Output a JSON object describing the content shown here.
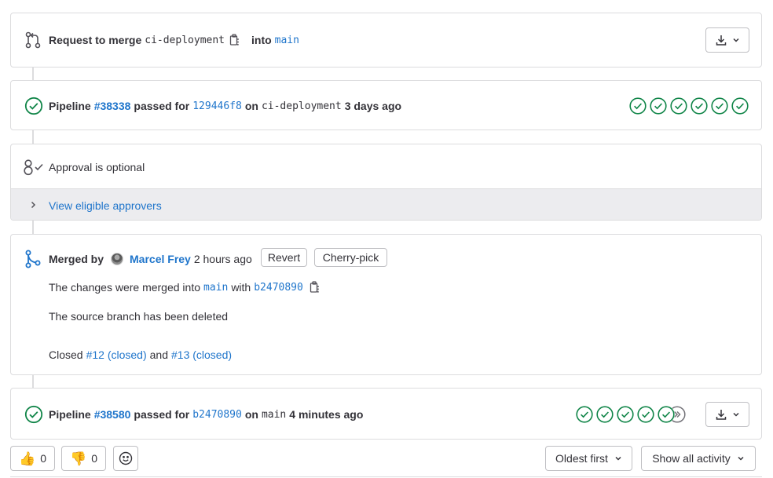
{
  "merge_request": {
    "prefix": "Request to merge",
    "source_branch": "ci-deployment",
    "into": "into",
    "target_branch": "main"
  },
  "pipeline1": {
    "label": "Pipeline",
    "id": "#38338",
    "passed_for": "passed for",
    "commit": "129446f8",
    "on": "on",
    "branch": "ci-deployment",
    "time": "3 days ago",
    "stages": [
      "passed",
      "passed",
      "passed",
      "passed",
      "passed",
      "passed"
    ]
  },
  "approval": {
    "text": "Approval is optional",
    "view_approvers": "View eligible approvers"
  },
  "merged": {
    "merged_by": "Merged by",
    "author": "Marcel Frey",
    "time": "2 hours ago",
    "revert": "Revert",
    "cherry_pick": "Cherry-pick",
    "changes_prefix": "The changes were merged into",
    "target": "main",
    "with": "with",
    "commit": "b2470890",
    "branch_deleted": "The source branch has been deleted",
    "closed_label": "Closed",
    "issue1": "#12 (closed)",
    "and": "and",
    "issue2": "#13 (closed)"
  },
  "pipeline2": {
    "label": "Pipeline",
    "id": "#38580",
    "passed_for": "passed for",
    "commit": "b2470890",
    "on": "on",
    "branch": "main",
    "time": "4 minutes ago",
    "stages": [
      "passed",
      "passed",
      "passed",
      "passed",
      "passed",
      "skipped"
    ]
  },
  "footer": {
    "thumbs_up_count": "0",
    "thumbs_down_count": "0",
    "sort_label": "Oldest first",
    "filter_label": "Show all activity"
  },
  "colors": {
    "success": "#108548",
    "link": "#1f75cb",
    "border": "#dcdcde"
  }
}
